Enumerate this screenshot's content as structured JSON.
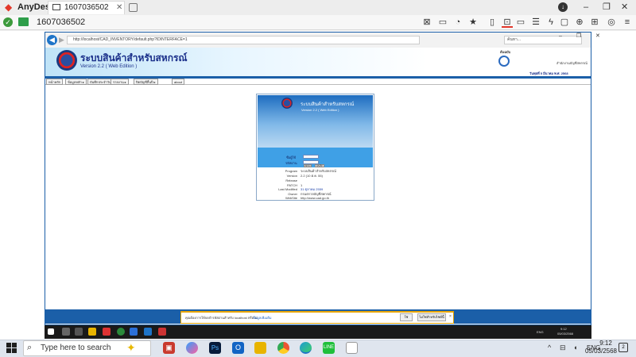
{
  "anydesk": {
    "app_name": "AnyDesk",
    "tab_title": "1607036502",
    "address": "1607036502",
    "window_controls": [
      "–",
      "❐",
      "✕"
    ],
    "toolbar_icons": [
      "chat-icon",
      "file-icon",
      "star-icon",
      "clipboard-icon",
      "keyboard-icon",
      "monitor-icon",
      "actions-icon",
      "lightning-icon",
      "whiteboard-icon",
      "privacy-icon",
      "add-icon",
      "settings-icon",
      "menu-icon"
    ]
  },
  "browser": {
    "url": "http://localhost/CAD_INVENTORY/default.php?IDINTERFACE=1",
    "search_placeholder": "ค้นหา...",
    "window_controls": "– ❐ ✕"
  },
  "banner": {
    "title": "ระบบสินค้าสำหรับสหกรณ์",
    "version": "Version 2.2 ( Web Edition )",
    "user_label": "ต้นฉบับ",
    "department": "สำนักงานบัญชีสหกรณ์",
    "date": "วันพุธที่ 5 มีนาคม พ.ศ. 2568"
  },
  "menu": [
    "หน้าหลัก",
    "ข้อมูลหลัก ▸",
    "บันทึกประจำวัน ▸",
    "รายงาน ▸",
    "ปิดบัญชีสิ้นปี ▸",
    "about"
  ],
  "login": {
    "title": "ระบบสินค้าสำหรับสหกรณ์",
    "version": "Version 2.2 ( Web Edition )",
    "user_label": "ชื่อผู้ใช้",
    "pass_label": "รหัสผ่าน",
    "login_button": "ตกลง",
    "reset_button": "ยกเลิก",
    "info": [
      {
        "key": "Program",
        "value": "ระบบสินค้าสำหรับสหกรณ์",
        "blue": false
      },
      {
        "key": "Version",
        "value": "2.2 (10 ต.ค. 55)",
        "blue": false
      },
      {
        "key": "Release",
        "value": "",
        "blue": false
      },
      {
        "key": "PATCH",
        "value": "1",
        "blue": false
      },
      {
        "key": "Last Modified",
        "value": "31 ตุลาคม 2559",
        "blue": true
      },
      {
        "key": "Owner",
        "value": "กรมตรวจบัญชีสหกรณ์",
        "blue": false
      },
      {
        "key": "WebSite",
        "value": "http://www.cad.go.th",
        "blue": false
      }
    ]
  },
  "notification": {
    "text": "คุณต้องการให้จดจำรหัสผ่านสำหรับ localhost หรือไม่",
    "link": "ข้อมูลเพิ่มเติม",
    "yes": "ใช่",
    "no": "ไม่ใช่สำหรับไซต์นี้",
    "close": "×"
  },
  "remote_taskbar": {
    "lang": "ENG",
    "time": "9:12",
    "date": "05/03/2568"
  },
  "taskbar": {
    "search_placeholder": "Type here to search",
    "lang": "ENG",
    "time": "9:12",
    "date": "05/03/2568"
  }
}
